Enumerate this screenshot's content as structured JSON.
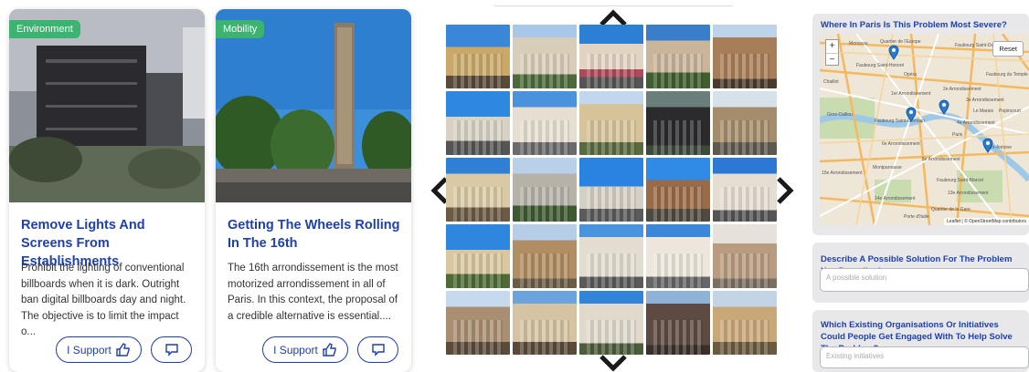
{
  "cards": [
    {
      "tag": "Environment",
      "title": "Remove Lights And Screens From Establishments",
      "description": "Prohibit the lighting of conventional billboards when it is dark. Outright ban digital billboards day and night. The objective is to limit the impact o...",
      "support_label": "I Support"
    },
    {
      "tag": "Mobility",
      "title": "Getting The Wheels Rolling In The 16th",
      "description": "The 16th arrondissement is the most motorized arrondissement in all of Paris. In this context, the proposal of a credible alternative is essential....",
      "support_label": "I Support"
    }
  ],
  "map_section": {
    "question": "Where In Paris Is This Problem Most Severe?",
    "zoom_in": "+",
    "zoom_out": "−",
    "reset_label": "Reset",
    "attribution": "Leaflet | © OpenStreetMap contributors",
    "labels": [
      "Monceau",
      "Quartier de l'Europe",
      "Faubourg Saint-Denis",
      "Opéra",
      "Faubourg du Temple",
      "Chaillot",
      "Faubourg Saint-Honoré",
      "1er Arrondissement",
      "2e Arrondissement",
      "3e Arrondissement",
      "Gros-Caillou",
      "Le Marais",
      "Faubourg Saint-Germain",
      "Popincourt",
      "4e Arrondissement",
      "6e Arrondissement",
      "Paris",
      "Saint-Antoine",
      "5e Arrondissement",
      "15e Arrondissement",
      "Montparnasse",
      "14e Arrondissement",
      "Quartier de la Gare",
      "Faubourg Saint-Marcel",
      "13e Arrondissement",
      "Porte d'Italie"
    ]
  },
  "solution_section": {
    "question": "Describe A Possible Solution For The Problem You Described",
    "placeholder": "A possible solution"
  },
  "initiatives_section": {
    "question": "Which Existing Organisations Or Initiatives Could People Get Engaged With To Help Solve The Problem?",
    "placeholder": "Existing initiatives"
  },
  "colors": {
    "accent": "#1e3fae",
    "tag": "#3cb371",
    "panel": "#e8e8ea"
  },
  "icons": [
    "thumbs-up-icon",
    "comment-icon",
    "chevron-up-icon",
    "chevron-down-icon",
    "chevron-left-icon",
    "chevron-right-icon",
    "map-marker-icon"
  ]
}
